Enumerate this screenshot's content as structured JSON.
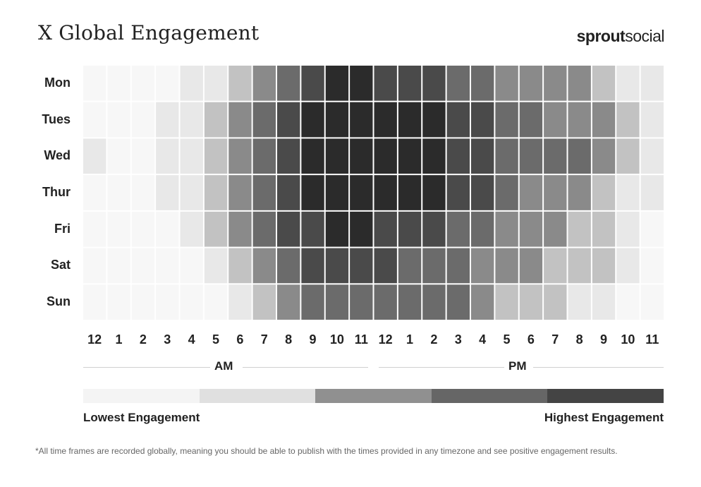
{
  "header": {
    "title": "X Global Engagement",
    "brand_bold": "sprout",
    "brand_regular": "social"
  },
  "colors": {
    "levels": [
      "#f7f7f7",
      "#e8e8e8",
      "#c2c2c2",
      "#8a8a8a",
      "#6b6b6b",
      "#4a4a4a",
      "#2b2b2b"
    ],
    "legend": [
      "#f4f4f4",
      "#e0e0e0",
      "#909090",
      "#666666",
      "#444444"
    ]
  },
  "chart_data": {
    "type": "heatmap",
    "title": "X Global Engagement",
    "rows": [
      "Mon",
      "Tues",
      "Wed",
      "Thur",
      "Fri",
      "Sat",
      "Sun"
    ],
    "columns": [
      "12",
      "1",
      "2",
      "3",
      "4",
      "5",
      "6",
      "7",
      "8",
      "9",
      "10",
      "11",
      "12",
      "1",
      "2",
      "3",
      "4",
      "5",
      "6",
      "7",
      "8",
      "9",
      "10",
      "11"
    ],
    "periods": [
      {
        "label": "AM",
        "hours": "12–11"
      },
      {
        "label": "PM",
        "hours": "12–11"
      }
    ],
    "value_scale": "0 = lowest engagement, 6 = highest engagement",
    "values": [
      [
        0,
        0,
        0,
        0,
        1,
        1,
        2,
        3,
        4,
        5,
        6,
        6,
        5,
        5,
        5,
        4,
        4,
        3,
        3,
        3,
        3,
        2,
        1,
        1
      ],
      [
        0,
        0,
        0,
        1,
        1,
        2,
        3,
        4,
        5,
        6,
        6,
        6,
        6,
        6,
        6,
        5,
        5,
        4,
        4,
        3,
        3,
        3,
        2,
        1
      ],
      [
        1,
        0,
        0,
        1,
        1,
        2,
        3,
        4,
        5,
        6,
        6,
        6,
        6,
        6,
        6,
        5,
        5,
        4,
        4,
        4,
        4,
        3,
        2,
        1
      ],
      [
        0,
        0,
        0,
        1,
        1,
        2,
        3,
        4,
        5,
        6,
        6,
        6,
        6,
        6,
        6,
        5,
        5,
        4,
        3,
        3,
        3,
        2,
        1,
        1
      ],
      [
        0,
        0,
        0,
        0,
        1,
        2,
        3,
        4,
        5,
        5,
        6,
        6,
        5,
        5,
        5,
        4,
        4,
        3,
        3,
        3,
        2,
        2,
        1,
        0
      ],
      [
        0,
        0,
        0,
        0,
        0,
        1,
        2,
        3,
        4,
        5,
        5,
        5,
        5,
        4,
        4,
        4,
        3,
        3,
        3,
        2,
        2,
        2,
        1,
        0
      ],
      [
        0,
        0,
        0,
        0,
        0,
        0,
        1,
        2,
        3,
        4,
        4,
        4,
        4,
        4,
        4,
        4,
        3,
        2,
        2,
        2,
        1,
        1,
        0,
        0
      ]
    ],
    "legend": {
      "low_label": "Lowest Engagement",
      "high_label": "Highest Engagement",
      "steps": 5
    }
  },
  "footnote": "*All time frames are recorded globally, meaning you should be able to publish with the times provided in any timezone and see positive engagement results."
}
